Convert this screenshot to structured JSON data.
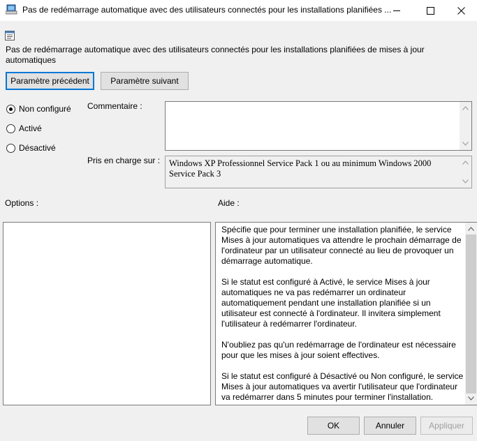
{
  "window": {
    "title": "Pas de redémarrage automatique avec des utilisateurs connectés pour les installations planifiées ..."
  },
  "policy": {
    "title": "Pas de redémarrage automatique avec des utilisateurs connectés pour les installations planifiées de mises à jour automatiques"
  },
  "nav": {
    "prev_label": "Paramètre précédent",
    "next_label": "Paramètre suivant"
  },
  "state": {
    "options": [
      {
        "label": "Non configuré",
        "selected": true
      },
      {
        "label": "Activé",
        "selected": false
      },
      {
        "label": "Désactivé",
        "selected": false
      }
    ]
  },
  "comment": {
    "label": "Commentaire :",
    "value": ""
  },
  "supported": {
    "label": "Pris en charge sur :",
    "value": "Windows XP Professionnel Service Pack 1 ou au minimum Windows 2000 Service Pack 3"
  },
  "options_panel": {
    "label": "Options :"
  },
  "help": {
    "label": "Aide :",
    "paragraphs": [
      "Spécifie que pour terminer une installation planifiée, le service Mises à jour automatiques va attendre le prochain démarrage de l'ordinateur par un utilisateur connecté au lieu de provoquer un démarrage automatique.",
      "Si le statut est configuré à Activé, le service Mises à jour automatiques ne va pas redémarrer un ordinateur automatiquement pendant une installation planifiée si un utilisateur est connecté à l'ordinateur. Il invitera simplement l'utilisateur à redémarrer l'ordinateur.",
      "N'oubliez pas qu'un redémarrage de l'ordinateur est nécessaire pour que les mises à jour soient effectives.",
      "Si le statut est configuré à Désactivé ou Non configuré, le service Mises à jour automatiques va avertir l'utilisateur que l'ordinateur va redémarrer dans 5 minutes pour terminer l'installation."
    ]
  },
  "footer": {
    "ok_label": "OK",
    "cancel_label": "Annuler",
    "apply_label": "Appliquer"
  }
}
